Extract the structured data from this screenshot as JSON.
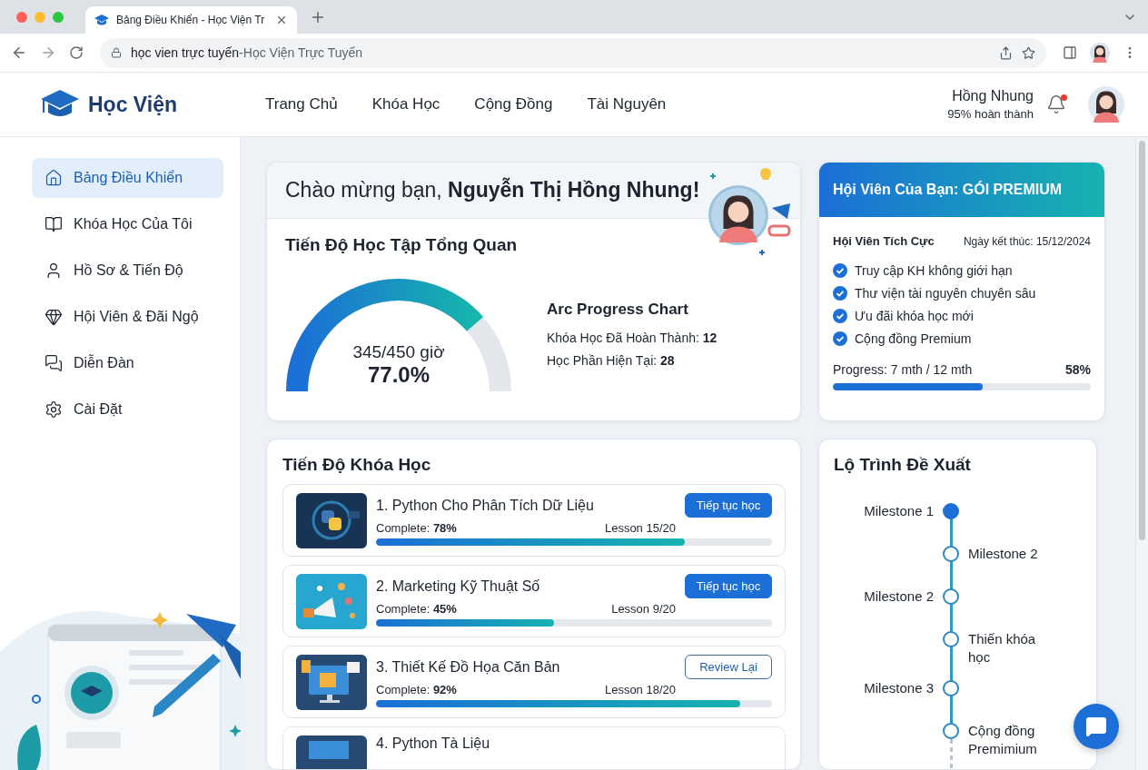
{
  "browser": {
    "tab_title": "Bảng Điều Khiển - Học Viện Tr",
    "address_host": "học vien trực tuyến",
    "address_rest": "-Học Viện Trực Tuyến"
  },
  "header": {
    "logo": "Học Viện",
    "nav": [
      {
        "label": "Trang Chủ"
      },
      {
        "label": "Khóa Học"
      },
      {
        "label": "Cộng Đồng"
      },
      {
        "label": "Tài Nguyên"
      }
    ],
    "user_name": "Hồng Nhung",
    "user_progress": "95% hoàn thành",
    "notification": true
  },
  "sidebar": {
    "items": [
      {
        "label": "Bảng Điều Khiển",
        "selected": true
      },
      {
        "label": "Khóa Học Của Tôi",
        "selected": false
      },
      {
        "label": "Hồ Sơ & Tiến Độ",
        "selected": false
      },
      {
        "label": "Hội Viên & Đãi Ngộ",
        "selected": false
      },
      {
        "label": "Diễn Đàn",
        "selected": false
      },
      {
        "label": "Cài Đặt",
        "selected": false
      }
    ]
  },
  "welcome": {
    "greeting": "Chào mừng bạn, **Nguyễn Thị Hồng Nhung!**",
    "overview_title": "Tiến Độ Học Tập Tổng Quan",
    "gauge": {
      "hours": "345/450 giờ",
      "percent": "77.0%"
    },
    "stats_title": "Arc Progress Chart",
    "stats": [
      "Khóa Học Đã Hoàn Thành: **12**",
      "Học Phần Hiện Tại: **28**"
    ]
  },
  "membership": {
    "title": "Hội Viên Của Bạn: GÓI PREMIUM",
    "status": "Hội Viên Tích Cực",
    "end_date": "Ngày kết thúc: 15/12/2024",
    "benefits": [
      "Truy cập KH không giới hạn",
      "Thư viện tài nguyên chuyên sâu",
      "Ưu đãi khóa học mới",
      "Cộng đồng Premium"
    ],
    "progress_label": "Progress: 7 mth / 12 mth",
    "progress_percent": "58%",
    "level": 0.58
  },
  "courses": {
    "title": "Tiến Độ Khóa Học",
    "items": [
      {
        "title": "1. Python Cho Phân Tích Dữ Liệu",
        "complete": "Complete: **78%**",
        "lesson": "Lesson 15/20",
        "level": 0.78,
        "button": {
          "label": "Tiếp tục học",
          "kind": "primary"
        }
      },
      {
        "title": "2. Marketing Kỹ Thuật Số",
        "complete": "Complete: **45%**",
        "lesson": "Lesson 9/20",
        "level": 0.45,
        "button": {
          "label": "Tiếp tục học",
          "kind": "primary"
        }
      },
      {
        "title": "3. Thiết Kế Đồ Họa Căn Bản",
        "complete": "Complete: **92%**",
        "lesson": "Lesson 18/20",
        "level": 0.92,
        "button": {
          "label": "Review Lại",
          "kind": "outline"
        }
      },
      {
        "title": "4. Python Tà Liệu"
      }
    ]
  },
  "roadmap": {
    "title": "Lộ Trình Đề Xuất",
    "milestones": [
      {
        "label": "Milestone 1",
        "label_right": false,
        "done": true
      },
      {
        "label": "Milestone 2",
        "label_right": true,
        "done": false
      },
      {
        "label": "Milestone 2",
        "label_right": false,
        "done": false
      },
      {
        "label": "Thiến khóa học",
        "label_right": true,
        "done": false
      },
      {
        "label": "Milestone 3",
        "label_right": false,
        "done": false
      },
      {
        "label": "Cộng đồng Premimium",
        "label_right": true,
        "done": false
      }
    ]
  }
}
